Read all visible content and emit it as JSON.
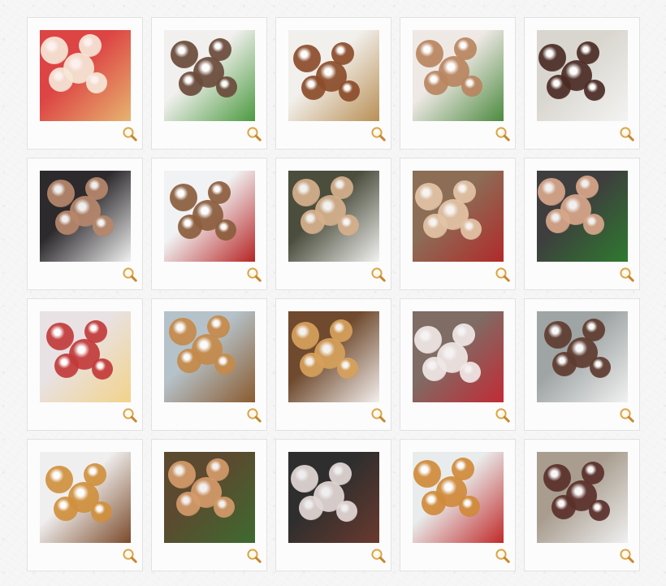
{
  "gallery": {
    "zoom_icon": "magnifier-icon",
    "items": [
      {
        "alt": "",
        "palette": [
          "#d44",
          "#f6e7d7",
          "#e7b46f"
        ]
      },
      {
        "alt": "",
        "palette": [
          "#f1f0ee",
          "#6a4a3a",
          "#4b9a3f"
        ]
      },
      {
        "alt": "",
        "palette": [
          "#f2f0ec",
          "#8b4c2a",
          "#b98f55"
        ]
      },
      {
        "alt": "",
        "palette": [
          "#efe9e6",
          "#b9855f",
          "#4c8a3f"
        ]
      },
      {
        "alt": "",
        "palette": [
          "#d9d6cf",
          "#4a2b24",
          "#f3f3f2"
        ]
      },
      {
        "alt": "",
        "palette": [
          "#2d2a2d",
          "#b7876b",
          "#f1f1f1"
        ]
      },
      {
        "alt": "",
        "palette": [
          "#f1f2f3",
          "#8b5d3d",
          "#b62424"
        ]
      },
      {
        "alt": "",
        "palette": [
          "#4b4d3d",
          "#d6b08c",
          "#f2f2f0"
        ]
      },
      {
        "alt": "",
        "palette": [
          "#8c6d56",
          "#e3c4a6",
          "#b12a2a"
        ]
      },
      {
        "alt": "",
        "palette": [
          "#3e3e3e",
          "#d8a68a",
          "#2e7a2f"
        ]
      },
      {
        "alt": "",
        "palette": [
          "#e8e2e4",
          "#c23a3a",
          "#f2d28a"
        ]
      },
      {
        "alt": "",
        "palette": [
          "#b5c2c9",
          "#c58a4a",
          "#8a5b2f"
        ]
      },
      {
        "alt": "",
        "palette": [
          "#6f4a2e",
          "#d7a15b",
          "#f4f0ee"
        ]
      },
      {
        "alt": "",
        "palette": [
          "#7e6c65",
          "#f0e8e6",
          "#c22b35"
        ]
      },
      {
        "alt": "",
        "palette": [
          "#9fa4a4",
          "#5e3b2f",
          "#f1f1f1"
        ]
      },
      {
        "alt": "",
        "palette": [
          "#f0efef",
          "#d0903d",
          "#7b4a2a"
        ]
      },
      {
        "alt": "",
        "palette": [
          "#5b4a2f",
          "#d49a6a",
          "#3e6a2f"
        ]
      },
      {
        "alt": "",
        "palette": [
          "#2e2e2e",
          "#e2d8d6",
          "#6a3a2f"
        ]
      },
      {
        "alt": "",
        "palette": [
          "#e9ecec",
          "#d08a3a",
          "#c02a2a"
        ]
      },
      {
        "alt": "",
        "palette": [
          "#a89d8f",
          "#5a2f2a",
          "#f0f0f0"
        ]
      }
    ]
  }
}
